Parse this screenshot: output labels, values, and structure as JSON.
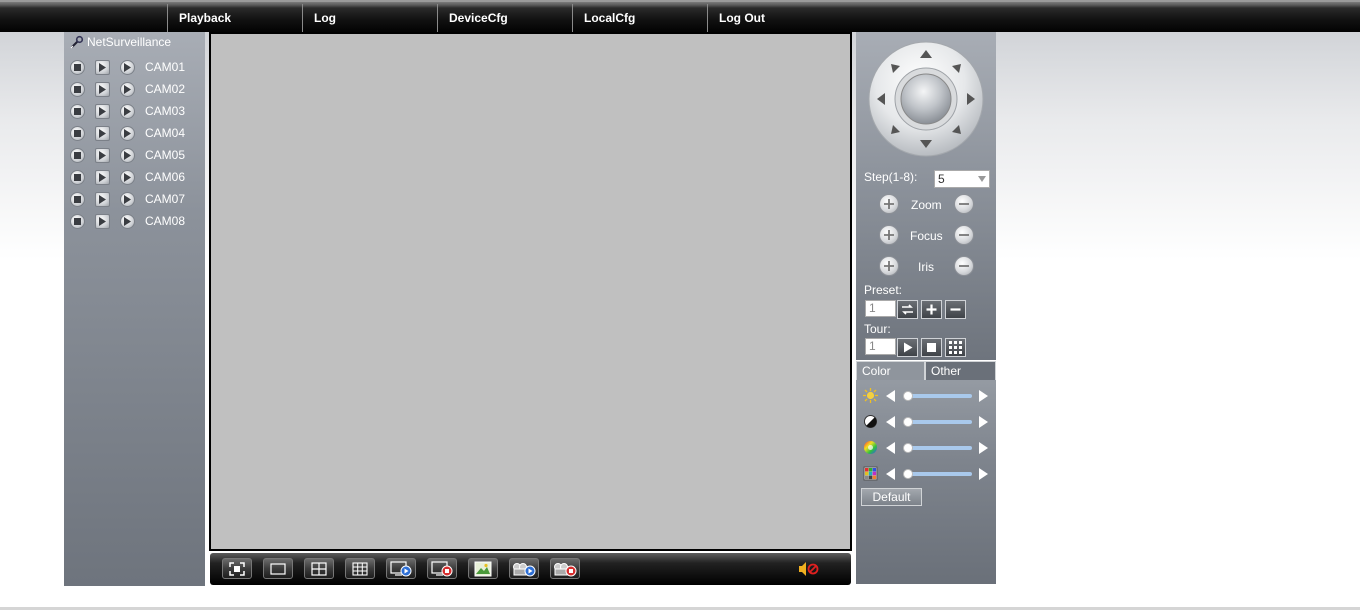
{
  "nav": {
    "items": [
      {
        "label": "Playback"
      },
      {
        "label": "Log"
      },
      {
        "label": "DeviceCfg"
      },
      {
        "label": "LocalCfg"
      },
      {
        "label": "Log Out"
      }
    ]
  },
  "device_tree": {
    "title": "NetSurveillance",
    "cameras": [
      {
        "label": "CAM01"
      },
      {
        "label": "CAM02"
      },
      {
        "label": "CAM03"
      },
      {
        "label": "CAM04"
      },
      {
        "label": "CAM05"
      },
      {
        "label": "CAM06"
      },
      {
        "label": "CAM07"
      },
      {
        "label": "CAM08"
      }
    ]
  },
  "toolbar": {
    "buttons": [
      "fullscreen-icon",
      "single-view-icon",
      "quad-view-icon",
      "nine-view-icon",
      "open-all-icon",
      "close-all-icon",
      "snapshot-icon",
      "record-icon",
      "stop-record-icon"
    ],
    "volume_icon": "speaker-muted-icon"
  },
  "ptz": {
    "step_label": "Step(1-8):",
    "step_value": "5",
    "zoom_label": "Zoom",
    "focus_label": "Focus",
    "iris_label": "Iris",
    "preset_label": "Preset:",
    "preset_value": "1",
    "tour_label": "Tour:",
    "tour_value": "1"
  },
  "color": {
    "tabs": [
      {
        "label": "Color"
      },
      {
        "label": "Other"
      }
    ],
    "sliders": [
      {
        "icon": "brightness-icon",
        "value": 0.05
      },
      {
        "icon": "contrast-icon",
        "value": 0.05
      },
      {
        "icon": "saturation-icon",
        "value": 0.05
      },
      {
        "icon": "hue-icon",
        "value": 0.05
      }
    ],
    "default_label": "Default"
  },
  "colors": {
    "nav_bg": "#000000",
    "panel_bg": "#8c929b",
    "video_bg": "#c0c0c0",
    "slider_track": "#a9c9ec"
  }
}
